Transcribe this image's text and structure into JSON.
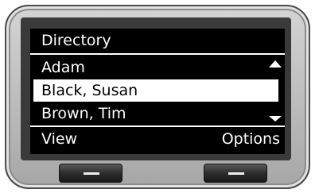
{
  "screen": {
    "title": "Directory",
    "entries": [
      {
        "name": "Adam",
        "selected": false
      },
      {
        "name": "Black, Susan",
        "selected": true
      },
      {
        "name": "Brown, Tim",
        "selected": false
      }
    ],
    "softkeys": {
      "left": "View",
      "right": "Options"
    }
  },
  "icons": {
    "scroll_up": "triangle-up-icon",
    "scroll_down": "triangle-down-icon",
    "softkey": "dash-icon"
  },
  "colors": {
    "screen_background": "#000000",
    "screen_text": "#ffffff",
    "highlight_background": "#ffffff",
    "highlight_text": "#000000",
    "device_body": "#bcbcbc"
  }
}
